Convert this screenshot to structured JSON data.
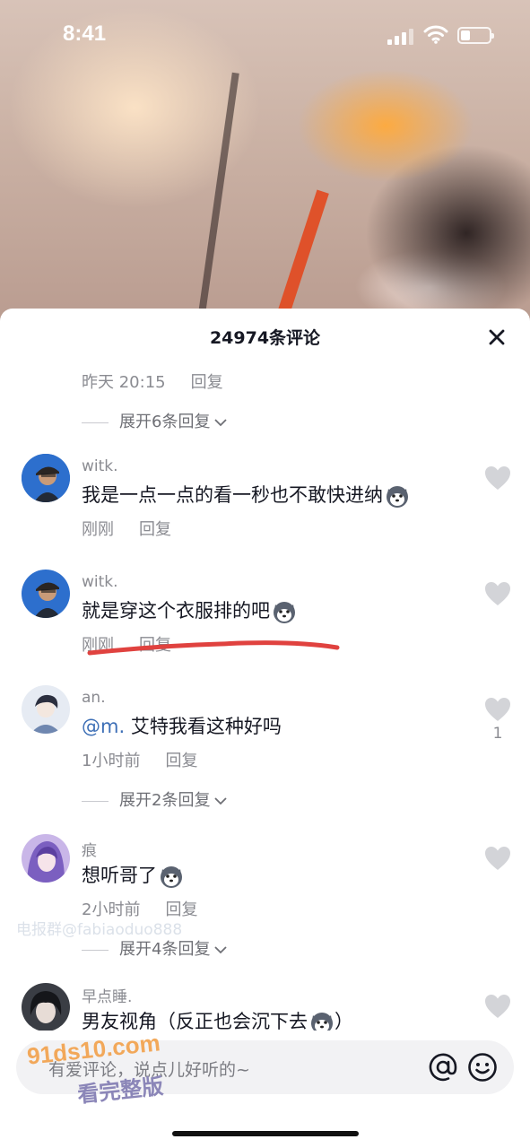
{
  "status_bar": {
    "time": "8:41"
  },
  "sheet": {
    "title": "24974条评论"
  },
  "top_reply_meta": {
    "time": "昨天 20:15",
    "reply": "回复"
  },
  "top_expand": {
    "label": "展开6条回复"
  },
  "comments": [
    {
      "username": "witk.",
      "text": "我是一点一点的看一秒也不敢快进纳",
      "time": "刚刚",
      "reply": "回复"
    },
    {
      "username": "witk.",
      "text": "就是穿这个衣服排的吧",
      "time": "刚刚",
      "reply": "回复"
    },
    {
      "username": "an.",
      "mention": "@m.",
      "text": " 艾特我看这种好吗",
      "time": "1小时前",
      "reply": "回复",
      "likes": "1",
      "expand": "展开2条回复"
    },
    {
      "username": "痕",
      "text": "想听哥了",
      "time": "2小时前",
      "reply": "回复",
      "expand": "展开4条回复"
    },
    {
      "username": "早点睡.",
      "text": "男友视角（反正也会沉下去",
      "text_end": "）"
    }
  ],
  "watermarks": {
    "overlay": "电报群@fabiaoduo888",
    "site": "91ds10.com",
    "promo": "看完整版"
  },
  "input": {
    "placeholder": "有爱评论，说点儿好听的~"
  },
  "colors": {
    "mention": "#3d6fb6",
    "underline": "#e0423f",
    "meta": "#8a8b91"
  }
}
